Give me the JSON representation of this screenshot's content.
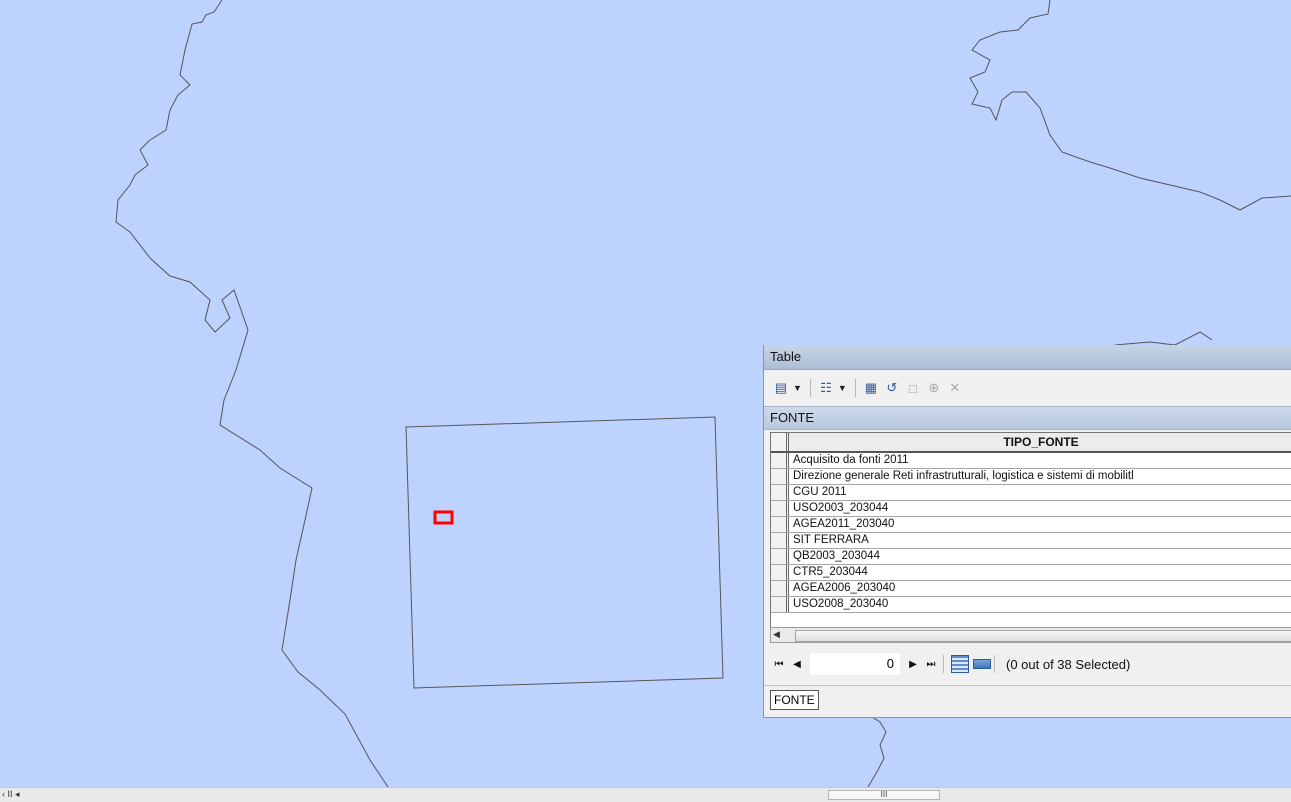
{
  "colors": {
    "map_background": "#bed2ff",
    "selection_highlight": "#ff0000",
    "boundary_line": "#555555"
  },
  "table_window": {
    "title": "Table",
    "toolbar_icons": [
      "table-options-icon",
      "dropdown-arrow-icon",
      "related-tables-icon",
      "dropdown-arrow-icon",
      "select-by-attributes-icon",
      "switch-selection-icon",
      "clear-selection-icon",
      "zoom-to-selected-icon",
      "delete-selected-icon"
    ],
    "table_name": "FONTE",
    "column_header": "TIPO_FONTE",
    "rows": [
      "Acquisito da  fonti 2011",
      "Direzione generale Reti infrastrutturali, logistica e sistemi di mobilitl",
      "CGU 2011",
      "USO2003_203044",
      "AGEA2011_203040",
      "SIT FERRARA",
      "QB2003_203044",
      "CTR5_203044",
      "AGEA2006_203040",
      "USO2008_203040"
    ],
    "navigation": {
      "record_value": "0",
      "selection_status": "(0 out of 38 Selected)"
    },
    "tab_label": "FONTE"
  },
  "status_bar": {
    "left_controls": "‹ II ◂",
    "scroll_grip": "III"
  }
}
